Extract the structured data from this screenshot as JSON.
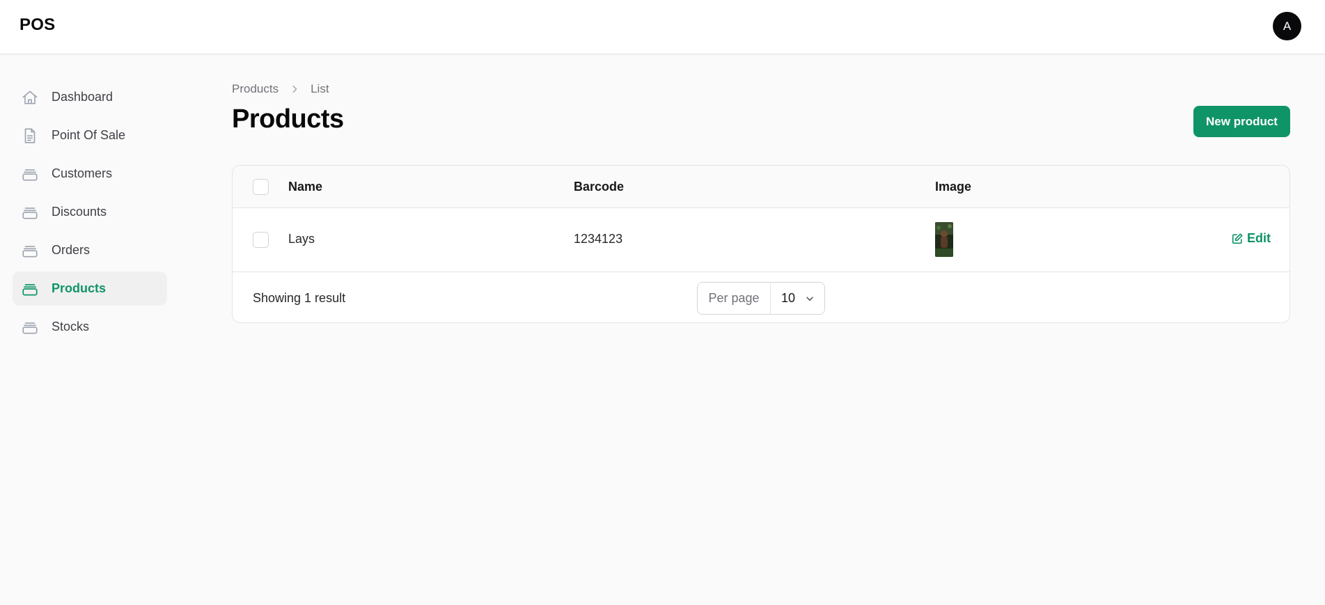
{
  "header": {
    "brand": "POS",
    "avatar_initial": "A"
  },
  "sidebar": {
    "items": [
      {
        "label": "Dashboard",
        "icon": "home-icon",
        "active": false
      },
      {
        "label": "Point Of Sale",
        "icon": "document-icon",
        "active": false
      },
      {
        "label": "Customers",
        "icon": "stack-icon",
        "active": false
      },
      {
        "label": "Discounts",
        "icon": "stack-icon",
        "active": false
      },
      {
        "label": "Orders",
        "icon": "stack-icon",
        "active": false
      },
      {
        "label": "Products",
        "icon": "stack-icon",
        "active": true
      },
      {
        "label": "Stocks",
        "icon": "stack-icon",
        "active": false
      }
    ]
  },
  "breadcrumb": {
    "parent": "Products",
    "current": "List"
  },
  "page": {
    "title": "Products",
    "new_button": "New product"
  },
  "table": {
    "columns": [
      "Name",
      "Barcode",
      "Image"
    ],
    "rows": [
      {
        "name": "Lays",
        "barcode": "1234123",
        "action": "Edit"
      }
    ],
    "footer": {
      "result_text": "Showing 1 result",
      "per_page_label": "Per page",
      "per_page_value": "10"
    }
  },
  "colors": {
    "accent": "#0f9467",
    "background": "#fafafa",
    "surface": "#ffffff",
    "border": "#e4e4e7"
  }
}
